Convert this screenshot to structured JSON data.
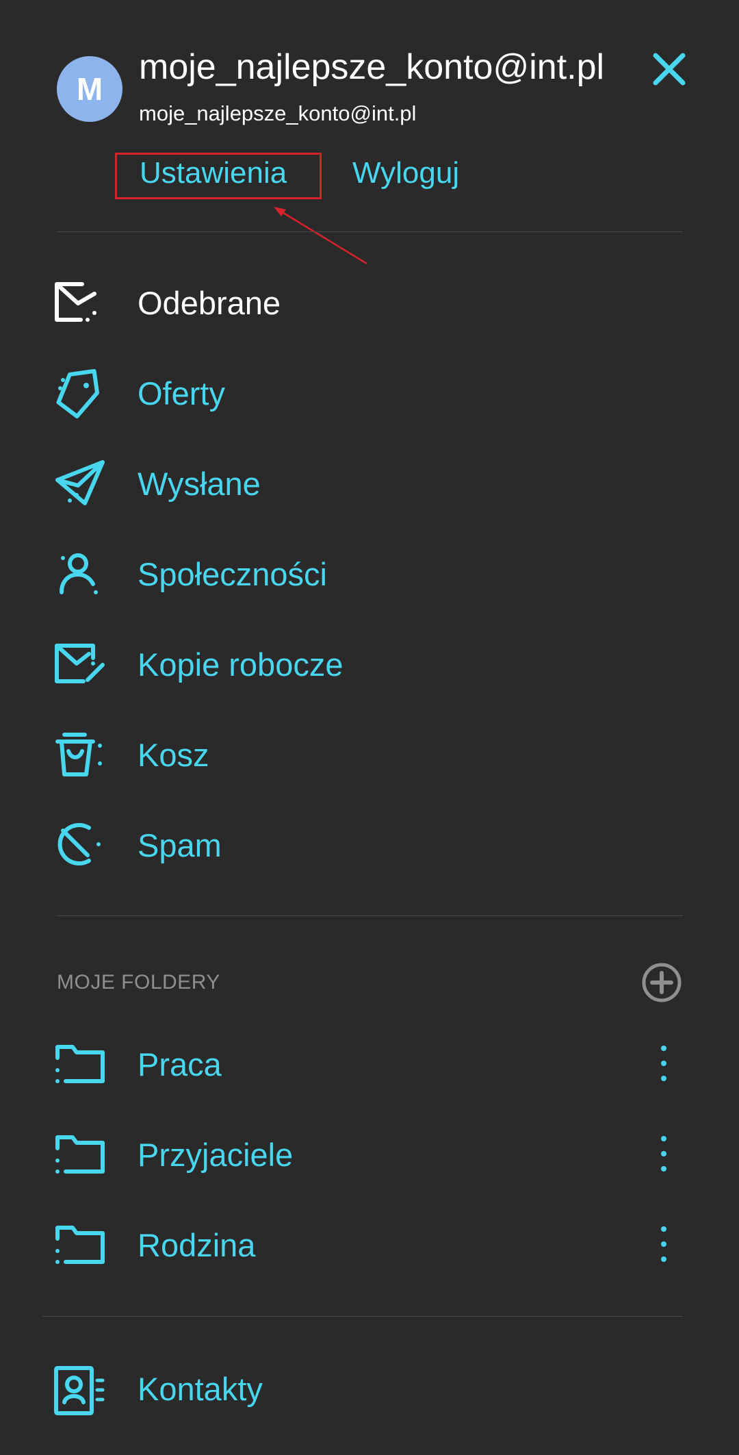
{
  "account": {
    "avatar_letter": "M",
    "name": "moje_najlepsze_konto@int.pl",
    "email": "moje_najlepsze_konto@int.pl",
    "settings_label": "Ustawienia",
    "logout_label": "Wyloguj"
  },
  "nav": {
    "items": [
      {
        "label": "Odebrane",
        "icon": "inbox-icon",
        "active": true
      },
      {
        "label": "Oferty",
        "icon": "tag-icon"
      },
      {
        "label": "Wysłane",
        "icon": "send-icon"
      },
      {
        "label": "Społeczności",
        "icon": "community-icon"
      },
      {
        "label": "Kopie robocze",
        "icon": "draft-icon"
      },
      {
        "label": "Kosz",
        "icon": "trash-icon"
      },
      {
        "label": "Spam",
        "icon": "spam-icon"
      }
    ]
  },
  "folders": {
    "section_title": "MOJE FOLDERY",
    "items": [
      {
        "label": "Praca",
        "icon": "folder-icon"
      },
      {
        "label": "Przyjaciele",
        "icon": "folder-icon"
      },
      {
        "label": "Rodzina",
        "icon": "folder-icon"
      }
    ]
  },
  "footer": {
    "contacts_label": "Kontakty",
    "icon": "contacts-icon"
  },
  "colors": {
    "background": "#2a2a2b",
    "accent": "#49d6ef",
    "avatar": "#8db4ec",
    "annotation": "#d8232a",
    "muted": "#8f8f91"
  }
}
